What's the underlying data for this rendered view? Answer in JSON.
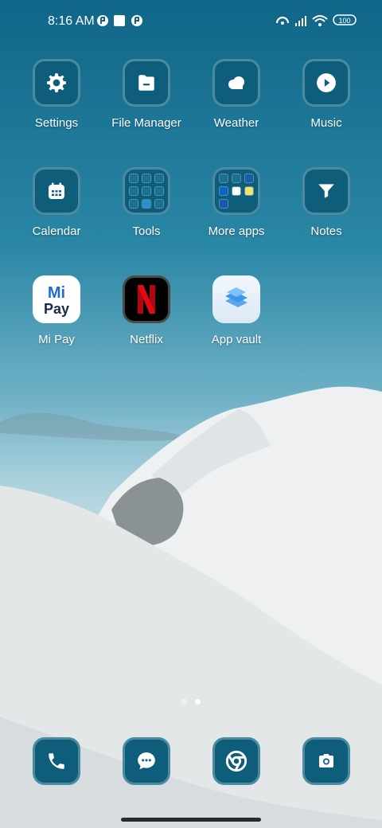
{
  "status_bar": {
    "time": "8:16 AM",
    "battery": "100",
    "icons": [
      "app-notification-icon",
      "square-notification-icon",
      "app-notification-icon",
      "hotspot-icon",
      "signal-icon",
      "wifi-icon",
      "battery-icon"
    ]
  },
  "apps": [
    {
      "label": "Settings",
      "icon": "gear-icon"
    },
    {
      "label": "File Manager",
      "icon": "folder-icon"
    },
    {
      "label": "Weather",
      "icon": "cloud-icon"
    },
    {
      "label": "Music",
      "icon": "play-icon"
    },
    {
      "label": "Calendar",
      "icon": "calendar-icon"
    },
    {
      "label": "Tools",
      "icon": "tools-folder-icon"
    },
    {
      "label": "More apps",
      "icon": "more-apps-folder-icon"
    },
    {
      "label": "Notes",
      "icon": "notes-icon"
    },
    {
      "label": "Mi Pay",
      "icon": "mi-pay-icon",
      "text": "Mi Pay"
    },
    {
      "label": "Netflix",
      "icon": "netflix-icon",
      "text": "N"
    },
    {
      "label": "App vault",
      "icon": "app-vault-icon"
    }
  ],
  "page_indicator": {
    "pages": 2,
    "active": 2
  },
  "dock": [
    {
      "name": "phone",
      "icon": "phone-icon"
    },
    {
      "name": "messages",
      "icon": "message-icon"
    },
    {
      "name": "browser",
      "icon": "chrome-icon"
    },
    {
      "name": "camera",
      "icon": "camera-icon"
    }
  ],
  "colors": {
    "tile": "#0e5e7b",
    "tile_border": "#4c8aa0",
    "netflix_red": "#e50914",
    "mi_blue": "#1f6bd6"
  }
}
